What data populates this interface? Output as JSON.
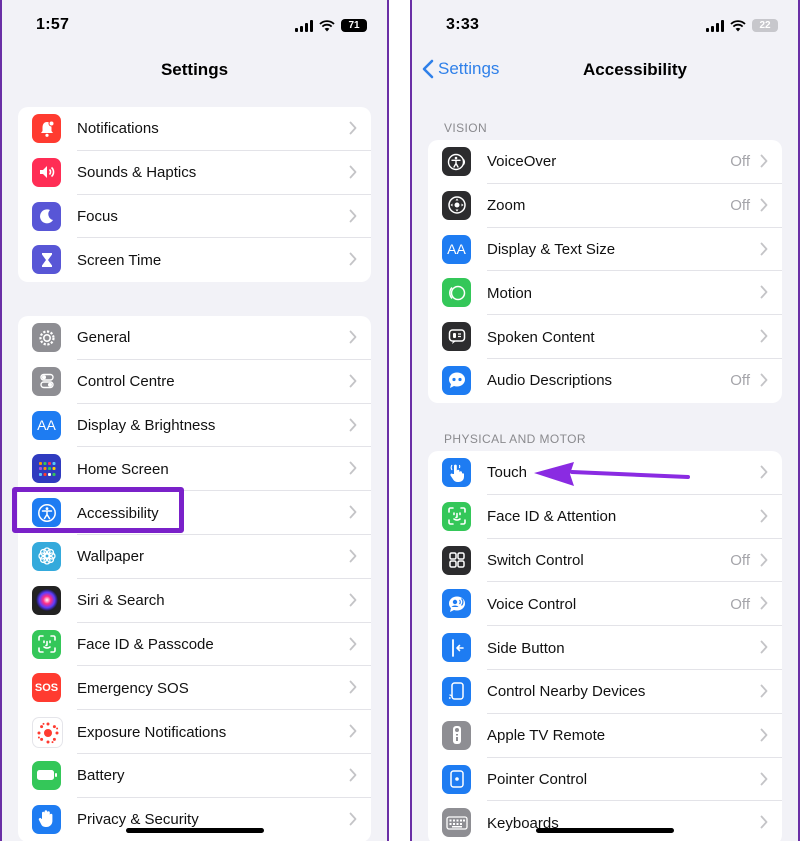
{
  "left_screen": {
    "status": {
      "time": "1:57",
      "battery": "71"
    },
    "title": "Settings",
    "group1": [
      {
        "label": "Notifications",
        "icon": "notifications-icon",
        "color": "#ff3b30"
      },
      {
        "label": "Sounds & Haptics",
        "icon": "speaker-icon",
        "color": "#ff2d55"
      },
      {
        "label": "Focus",
        "icon": "moon-icon",
        "color": "#5856d6"
      },
      {
        "label": "Screen Time",
        "icon": "hourglass-icon",
        "color": "#5856d6"
      }
    ],
    "group2": [
      {
        "label": "General",
        "icon": "gear-icon",
        "color": "#8e8e93"
      },
      {
        "label": "Control Centre",
        "icon": "toggles-icon",
        "color": "#8e8e93"
      },
      {
        "label": "Display & Brightness",
        "icon": "text-size-icon",
        "color": "#1e7cf2"
      },
      {
        "label": "Home Screen",
        "icon": "home-grid-icon",
        "color": "#2f3bbf"
      },
      {
        "label": "Accessibility",
        "icon": "accessibility-icon",
        "color": "#1e7cf2"
      },
      {
        "label": "Wallpaper",
        "icon": "flower-icon",
        "color": "#34aadc"
      },
      {
        "label": "Siri & Search",
        "icon": "siri-icon",
        "color": "#222"
      },
      {
        "label": "Face ID & Passcode",
        "icon": "face-id-icon",
        "color": "#34c759"
      },
      {
        "label": "Emergency SOS",
        "icon": "sos-icon",
        "color": "#ff3b30"
      },
      {
        "label": "Exposure Notifications",
        "icon": "exposure-icon",
        "color": "#ffffff"
      },
      {
        "label": "Battery",
        "icon": "battery-icon",
        "color": "#34c759"
      },
      {
        "label": "Privacy & Security",
        "icon": "hand-icon",
        "color": "#1e7cf2"
      }
    ]
  },
  "right_screen": {
    "status": {
      "time": "3:33",
      "battery": "22"
    },
    "back_label": "Settings",
    "title": "Accessibility",
    "vision_header": "VISION",
    "vision": [
      {
        "label": "VoiceOver",
        "value": "Off",
        "icon": "voiceover-icon",
        "color": "#2c2c2e"
      },
      {
        "label": "Zoom",
        "value": "Off",
        "icon": "zoom-icon",
        "color": "#2c2c2e"
      },
      {
        "label": "Display & Text Size",
        "value": "",
        "icon": "text-size-icon",
        "color": "#1e7cf2"
      },
      {
        "label": "Motion",
        "value": "",
        "icon": "motion-icon",
        "color": "#34c759"
      },
      {
        "label": "Spoken Content",
        "value": "",
        "icon": "speech-icon",
        "color": "#2c2c2e"
      },
      {
        "label": "Audio Descriptions",
        "value": "Off",
        "icon": "quote-bubble-icon",
        "color": "#1e7cf2"
      }
    ],
    "physical_header": "PHYSICAL AND MOTOR",
    "physical": [
      {
        "label": "Touch",
        "value": "",
        "icon": "hand-pointer-icon",
        "color": "#1e7cf2"
      },
      {
        "label": "Face ID & Attention",
        "value": "",
        "icon": "face-id-icon",
        "color": "#34c759"
      },
      {
        "label": "Switch Control",
        "value": "Off",
        "icon": "switch-grid-icon",
        "color": "#2c2c2e"
      },
      {
        "label": "Voice Control",
        "value": "Off",
        "icon": "voice-control-icon",
        "color": "#1e7cf2"
      },
      {
        "label": "Side Button",
        "value": "",
        "icon": "side-button-icon",
        "color": "#1e7cf2"
      },
      {
        "label": "Control Nearby Devices",
        "value": "",
        "icon": "nearby-devices-icon",
        "color": "#1e7cf2"
      },
      {
        "label": "Apple TV Remote",
        "value": "",
        "icon": "remote-icon",
        "color": "#8e8e93"
      },
      {
        "label": "Pointer Control",
        "value": "",
        "icon": "pointer-icon",
        "color": "#1e7cf2"
      },
      {
        "label": "Keyboards",
        "value": "",
        "icon": "keyboard-icon",
        "color": "#8e8e93"
      }
    ]
  },
  "annotation": {
    "highlight_color": "#7a21c9",
    "arrow_color": "#8a2be2"
  }
}
